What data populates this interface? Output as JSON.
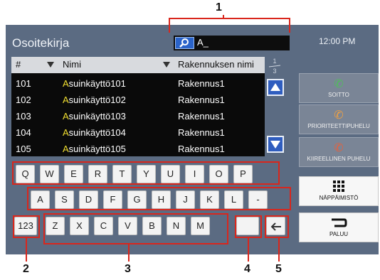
{
  "header": {
    "title": "Osoitekirja",
    "clock": "12:00 PM"
  },
  "search": {
    "value": "A_",
    "icon": "search-icon"
  },
  "table": {
    "columns": [
      "#",
      "Nimi",
      "Rakennuksen nimi"
    ],
    "rows": [
      {
        "num": "101",
        "name_hl": "A",
        "name_rest": "suinkäyttö101",
        "building": "Rakennus1"
      },
      {
        "num": "102",
        "name_hl": "A",
        "name_rest": "suinkäyttö102",
        "building": "Rakennus1"
      },
      {
        "num": "103",
        "name_hl": "A",
        "name_rest": "suinkäyttö103",
        "building": "Rakennus1"
      },
      {
        "num": "104",
        "name_hl": "A",
        "name_rest": "suinkäyttö104",
        "building": "Rakennus1"
      },
      {
        "num": "105",
        "name_hl": "A",
        "name_rest": "suinkäyttö105",
        "building": "Rakennus1"
      }
    ]
  },
  "pagination": {
    "current": "1",
    "total": "3"
  },
  "keyboard": {
    "row1": [
      "Q",
      "W",
      "E",
      "R",
      "T",
      "Y",
      "U",
      "I",
      "O",
      "P"
    ],
    "row2": [
      "A",
      "S",
      "D",
      "F",
      "G",
      "H",
      "J",
      "K",
      "L",
      "-"
    ],
    "row3": [
      "123",
      "Z",
      "X",
      "C",
      "V",
      "B",
      "N",
      "M"
    ],
    "space": "",
    "backspace_icon": "backspace-arrow-icon"
  },
  "side_buttons": {
    "call": "SOITTO",
    "priority_call": "PRIORITEETTIPUHELU",
    "urgent_call": "KIIREELLINEN PUHELU",
    "keypad": "NÄPPÄIMISTÖ",
    "back": "PALUU"
  },
  "callouts": [
    "1",
    "2",
    "3",
    "4",
    "5"
  ],
  "colors": {
    "screen_bg": "#5b6b82",
    "highlight": "#f2e030",
    "callout_red": "#d9261c"
  }
}
